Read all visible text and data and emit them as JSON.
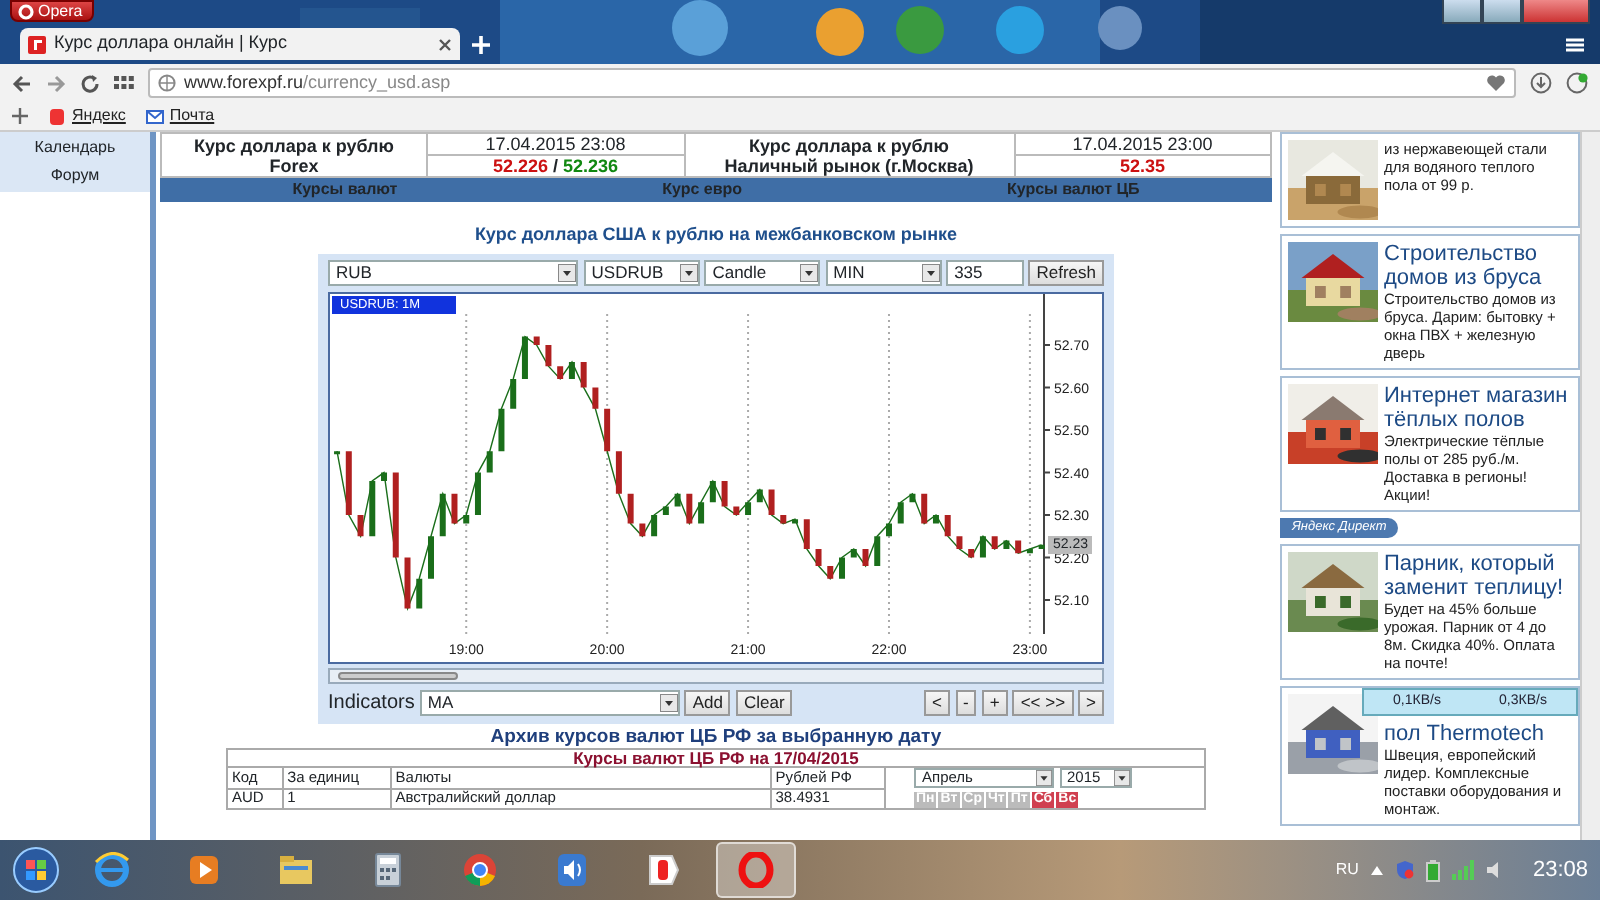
{
  "browser": {
    "opera_button": "Opera",
    "tab": {
      "title": "Курс доллара онлайн | Курс",
      "selected": true
    },
    "address": {
      "domain": "www.forexpf.ru",
      "path": "/currency_usd.asp"
    },
    "bookmarks": [
      "Яндекс",
      "Почта"
    ]
  },
  "sidebar": {
    "links": [
      "Календарь",
      "Форум"
    ]
  },
  "rates": [
    {
      "title": "Курс доллара к рублю",
      "subtitle": "Forex",
      "time": "17.04.2015 23:08",
      "separator": "/",
      "prices": [
        {
          "text": "52.226",
          "color": "#cc1111"
        },
        {
          "text": "52.236",
          "color": "#118811"
        }
      ]
    },
    {
      "title": "Курс доллара к рублю",
      "subtitle": "Наличный рынок (г.Москва)",
      "time": "17.04.2015 23:00",
      "prices": [
        {
          "text": "52.35",
          "color": "#cc1111"
        }
      ]
    }
  ],
  "nav_links": [
    "Курсы валют",
    "Курс евро",
    "Курсы валют ЦБ"
  ],
  "chart_panel": {
    "title": "Курс доллара США к рублю на межбанковском рынке",
    "selects": [
      "RUB",
      "USDRUB",
      "Candle",
      "MIN"
    ],
    "count": "335",
    "refresh": "Refresh",
    "legend": "USDRUB: 1M",
    "last_price": "52.23",
    "chart_data": {
      "type": "line",
      "grid": true,
      "ylim": [
        52.02,
        52.82
      ],
      "categories": [
        null,
        null,
        null,
        null,
        null,
        null,
        null,
        null,
        null,
        null,
        null,
        "19:00",
        null,
        null,
        null,
        null,
        null,
        null,
        null,
        null,
        null,
        null,
        null,
        "20:00",
        null,
        null,
        null,
        null,
        null,
        null,
        null,
        null,
        null,
        null,
        null,
        "21:00",
        null,
        null,
        null,
        null,
        null,
        null,
        null,
        null,
        null,
        null,
        null,
        "22:00",
        null,
        null,
        null,
        null,
        null,
        null,
        null,
        null,
        null,
        null,
        null,
        "23:00",
        null
      ],
      "yticks": [
        {
          "value": 52.1,
          "label": "52.10"
        },
        {
          "value": 52.2,
          "label": "52.20"
        },
        {
          "value": 52.3,
          "label": "52.30"
        },
        {
          "value": 52.4,
          "label": "52.40"
        },
        {
          "value": 52.5,
          "label": "52.50"
        },
        {
          "value": 52.6,
          "label": "52.60"
        },
        {
          "value": 52.7,
          "label": "52.70"
        }
      ],
      "series": [
        {
          "color": "#1a6e1a",
          "values": [
            52.45,
            52.3,
            52.25,
            52.38,
            52.4,
            52.2,
            52.08,
            52.15,
            52.25,
            52.35,
            52.28,
            52.3,
            52.4,
            52.45,
            52.55,
            52.62,
            52.72,
            52.7,
            52.65,
            52.62,
            52.66,
            52.6,
            52.55,
            52.45,
            52.35,
            52.28,
            52.25,
            52.3,
            52.32,
            52.35,
            52.28,
            52.33,
            52.38,
            52.32,
            52.3,
            52.33,
            52.36,
            52.3,
            52.28,
            52.29,
            52.22,
            52.18,
            52.15,
            52.2,
            52.22,
            52.18,
            52.25,
            52.28,
            52.33,
            52.35,
            52.28,
            52.3,
            52.25,
            52.22,
            52.2,
            52.25,
            52.22,
            52.24,
            52.21,
            52.22,
            52.23
          ]
        }
      ]
    },
    "indicators_label": "Indicators",
    "indicator": "MA",
    "add": "Add",
    "clear": "Clear",
    "nav_buttons": [
      "<",
      "-",
      "+",
      "<< >>",
      ">"
    ]
  },
  "archive": {
    "title": "Архив курсов валют ЦБ РФ за выбранную дату",
    "subtitle": "Курсы валют ЦБ РФ на 17/04/2015",
    "columns": [
      "Код",
      "За единиц",
      "Валюты",
      "Рублей РФ"
    ],
    "rows": [
      [
        "AUD",
        "1",
        "Австралийский доллар",
        "38.4931"
      ]
    ],
    "month": "Апрель",
    "year": "2015",
    "weekdays": [
      {
        "label": "Пн",
        "weekend": false
      },
      {
        "label": "Вт",
        "weekend": false
      },
      {
        "label": "Ср",
        "weekend": false
      },
      {
        "label": "Чт",
        "weekend": false
      },
      {
        "label": "Пт",
        "weekend": false
      },
      {
        "label": "Сб",
        "weekend": true
      },
      {
        "label": "Вс",
        "weekend": true
      }
    ]
  },
  "ads_top": [
    {
      "text": "из нержавеющей стали для водяного теплого пола от 99 р."
    },
    {
      "title": "Строительство домов из бруса",
      "text": "Строительство домов из бруса. Дарим: бытовку + окна ПВХ + железную дверь"
    },
    {
      "title": "Интернет магазин тёплых полов",
      "text": "Электрические тёплые полы от 285 руб./м. Доставка в регионы! Акции!"
    }
  ],
  "ads_label": "Яндекс Директ",
  "ads_bottom": [
    {
      "title": "Парник, который заменит теплицу!",
      "text": "Будет на 45% больше урожая. Парник от 4 до 8м. Скидка 40%. Оплата на почте!"
    },
    {
      "title": "пол Thermotech",
      "text": "Швеция, европейский лидер. Комплексные поставки оборудования и монтаж."
    }
  ],
  "net_meter": [
    "0,1КВ/s",
    "0,3КВ/s"
  ],
  "taskbar": {
    "apps": [
      {
        "kind": "ie",
        "selected": false
      },
      {
        "kind": "media",
        "selected": false
      },
      {
        "kind": "folder",
        "selected": false
      },
      {
        "kind": "calc",
        "selected": false
      },
      {
        "kind": "chrome",
        "selected": false
      },
      {
        "kind": "speaker",
        "selected": false
      },
      {
        "kind": "yandex",
        "selected": false
      },
      {
        "kind": "opera",
        "selected": true
      }
    ],
    "language": "RU",
    "clock": "23:08"
  }
}
